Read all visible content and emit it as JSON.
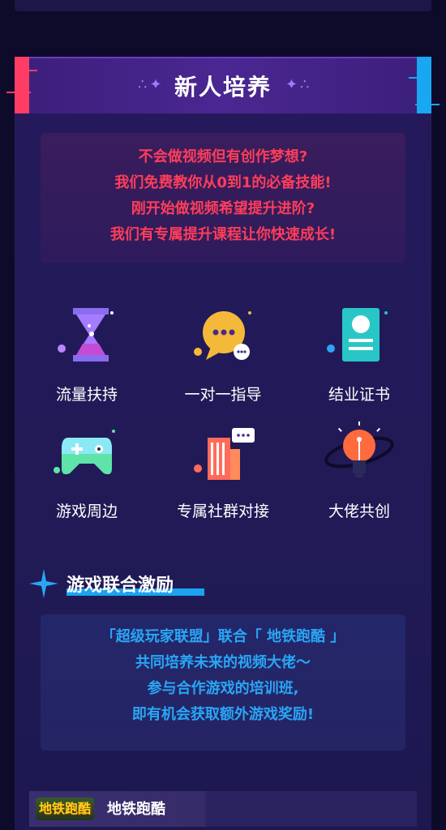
{
  "header": {
    "title": "新人培养"
  },
  "intro": {
    "lines": [
      "不会做视频但有创作梦想?",
      "我们免费教你从0到1的必备技能!",
      "刚开始做视频希望提升进阶?",
      "我们有专属提升课程让你快速成长!"
    ]
  },
  "features": [
    {
      "label": "流量扶持",
      "icon": "hourglass-icon"
    },
    {
      "label": "一对一指导",
      "icon": "chat-bubble-icon"
    },
    {
      "label": "结业证书",
      "icon": "certificate-icon"
    },
    {
      "label": "游戏周边",
      "icon": "gamepad-icon"
    },
    {
      "label": "专属社群对接",
      "icon": "community-icon"
    },
    {
      "label": "大佬共创",
      "icon": "lightbulb-icon"
    }
  ],
  "section2": {
    "title": "游戏联合激励",
    "lines": [
      "「超级玩家联盟」联合「 地铁跑酷 」",
      "共同培养未来的视频大佬～",
      "参与合作游戏的培训班,",
      "即有机会获取额外游戏奖励!"
    ]
  },
  "game": {
    "logo_text": "地铁跑酷",
    "name": "地铁跑酷"
  },
  "colors": {
    "accent_red": "#ff3d5a",
    "accent_blue": "#29a6f5",
    "panel": "#241a5c"
  }
}
